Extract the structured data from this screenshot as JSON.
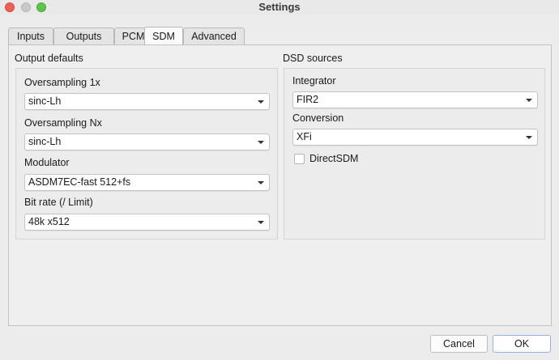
{
  "window": {
    "title": "Settings"
  },
  "tabs": [
    {
      "label": "Inputs"
    },
    {
      "label": "Outputs"
    },
    {
      "label": "PCM"
    },
    {
      "label": "SDM",
      "active": true
    },
    {
      "label": "Advanced"
    }
  ],
  "output_defaults": {
    "title": "Output defaults",
    "oversampling_1x": {
      "label": "Oversampling 1x",
      "value": "sinc-Lh"
    },
    "oversampling_nx": {
      "label": "Oversampling Nx",
      "value": "sinc-Lh"
    },
    "modulator": {
      "label": "Modulator",
      "value": "ASDM7EC-fast 512+fs"
    },
    "bit_rate": {
      "label": "Bit rate (/ Limit)",
      "value": "48k x512"
    }
  },
  "dsd_sources": {
    "title": "DSD sources",
    "integrator": {
      "label": "Integrator",
      "value": "FIR2"
    },
    "conversion": {
      "label": "Conversion",
      "value": "XFi"
    },
    "direct_sdm": {
      "label": "DirectSDM",
      "checked": false
    }
  },
  "buttons": {
    "cancel": "Cancel",
    "ok": "OK"
  },
  "colors": {
    "close": "#ee5f58",
    "maximize": "#5fc54a",
    "default_button_border": "#8fb2e2"
  }
}
